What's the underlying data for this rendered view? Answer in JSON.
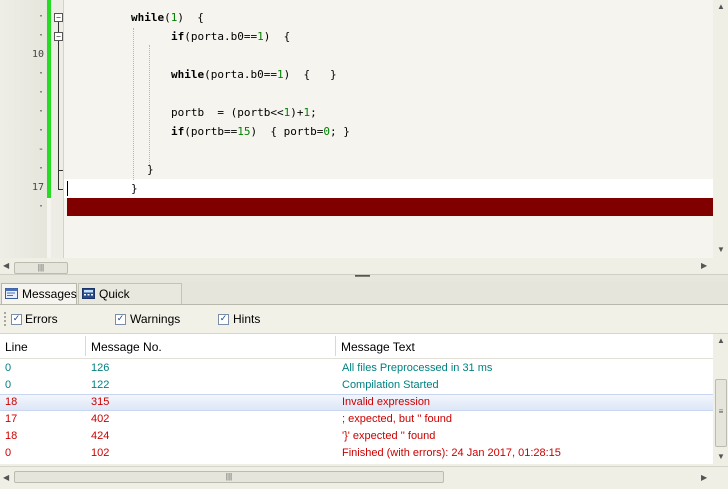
{
  "editor": {
    "gutter_numbers": [
      "10",
      "17"
    ],
    "code": {
      "l1": {
        "kw": "while",
        "a": "(",
        "n": "1",
        "b": ")  {"
      },
      "l2": {
        "kw": "if",
        "a": "(porta.b0==",
        "n": "1",
        "b": ")  {"
      },
      "l3": {
        "kw": "while",
        "a": "(porta.b0==",
        "n": "1",
        "b": ")  {   }"
      },
      "l4": {
        "a": "portb  = (portb<<",
        "n1": "1",
        "m": ")+",
        "n2": "1",
        "b": ";"
      },
      "l5": {
        "kw": "if",
        "a": "(portb==",
        "n": "15",
        "b": ")  { portb=",
        "n2": "0",
        "c": "; }"
      },
      "l6": "}",
      "l7": "}"
    },
    "fold_minus": "−"
  },
  "tabs": {
    "messages": "Messages",
    "quick_converter": "Quick Converter"
  },
  "filters": {
    "errors": {
      "label": "Errors",
      "checked": "✓"
    },
    "warnings": {
      "label": "Warnings",
      "checked": "✓"
    },
    "hints": {
      "label": "Hints",
      "checked": "✓"
    }
  },
  "table": {
    "headers": {
      "line": "Line",
      "msgno": "Message No.",
      "text": "Message Text"
    },
    "rows": [
      {
        "line": "0",
        "no": "126",
        "text": "All files Preprocessed in 31 ms"
      },
      {
        "line": "0",
        "no": "122",
        "text": "Compilation Started"
      },
      {
        "line": "18",
        "no": "315",
        "text": "Invalid expression"
      },
      {
        "line": "17",
        "no": "402",
        "text": "; expected, but '' found"
      },
      {
        "line": "18",
        "no": "424",
        "text": "'}' expected '' found"
      },
      {
        "line": "0",
        "no": "102",
        "text": "Finished (with errors): 24 Jan 2017, 01:28:15"
      }
    ]
  },
  "colors": {
    "info": "#008080",
    "error": "#cc0000",
    "error_line": "#800000",
    "change_bar": "#22dd22"
  }
}
